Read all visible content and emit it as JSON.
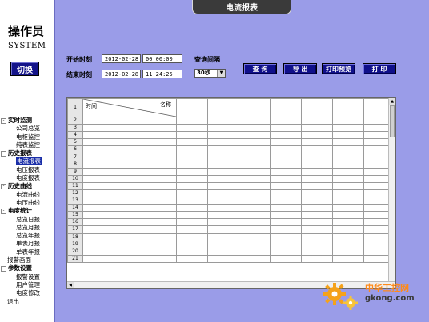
{
  "sidebar": {
    "operator_label": "操作员",
    "username": "SYSTEM",
    "switch_label": "切换",
    "nav": [
      {
        "type": "group",
        "toggle": "-",
        "label": "实时监测"
      },
      {
        "type": "child",
        "label": "公司总览"
      },
      {
        "type": "child",
        "label": "电柜监控"
      },
      {
        "type": "child",
        "label": "纯表监控"
      },
      {
        "type": "group",
        "toggle": "-",
        "label": "历史报表"
      },
      {
        "type": "child",
        "label": "电流报表",
        "selected": true
      },
      {
        "type": "child",
        "label": "电压报表"
      },
      {
        "type": "child",
        "label": "电度报表"
      },
      {
        "type": "group",
        "toggle": "-",
        "label": "历史曲线"
      },
      {
        "type": "child",
        "label": "电流曲线"
      },
      {
        "type": "child",
        "label": "电压曲线"
      },
      {
        "type": "group",
        "toggle": "-",
        "label": "电度统计"
      },
      {
        "type": "child",
        "label": "总览日报"
      },
      {
        "type": "child",
        "label": "总览月报"
      },
      {
        "type": "child",
        "label": "总览年报"
      },
      {
        "type": "child",
        "label": "单表月报"
      },
      {
        "type": "child",
        "label": "单表年报"
      },
      {
        "type": "root",
        "label": "报警画面"
      },
      {
        "type": "group",
        "toggle": "-",
        "label": "参数设置"
      },
      {
        "type": "child",
        "label": "报警设置"
      },
      {
        "type": "child",
        "label": "用户管理"
      },
      {
        "type": "child",
        "label": "电度修改"
      },
      {
        "type": "root",
        "label": "退出"
      }
    ]
  },
  "header": {
    "title": "电流报表"
  },
  "query": {
    "start_label": "开始时刻",
    "start_date": "2012-02-28",
    "start_time": "00:00:00",
    "end_label": "结束时刻",
    "end_date": "2012-02-28",
    "end_time": "11:24:25",
    "interval_label": "查询间隔",
    "interval_value": "30秒"
  },
  "buttons": {
    "query": "查 询",
    "export": "导 出",
    "print_preview": "打印预览",
    "print": "打 印"
  },
  "table": {
    "header_time": "时间",
    "header_name": "名称",
    "row_numbers": [
      "1",
      "2",
      "3",
      "4",
      "5",
      "6",
      "7",
      "8",
      "9",
      "10",
      "11",
      "12",
      "13",
      "14",
      "15",
      "16",
      "17",
      "18",
      "19",
      "20",
      "21"
    ]
  },
  "watermark": {
    "line1": "中华工控网",
    "line2": "gkong.com"
  },
  "colors": {
    "background": "#9a9ce8",
    "button": "#10108a",
    "title_tab": "#3a3a3a",
    "selected_nav": "#1a2ea8"
  }
}
